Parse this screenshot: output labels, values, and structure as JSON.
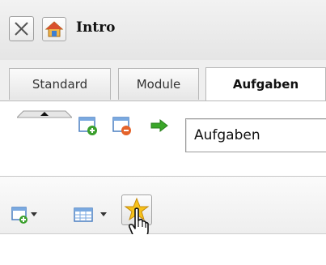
{
  "window": {
    "title": "Intro",
    "icons": {
      "close": "close-icon",
      "home": "home-icon"
    }
  },
  "tabs": [
    {
      "label": "Standard",
      "active": false
    },
    {
      "label": "Module",
      "active": false
    },
    {
      "label": "Aufgaben",
      "active": true
    }
  ],
  "toolbar": {
    "icons": [
      "collapse-handle-icon",
      "window-add-icon",
      "window-remove-icon",
      "arrow-right-icon"
    ],
    "select": {
      "value": "Aufgaben"
    }
  },
  "toolbar2": {
    "icons": [
      "new-window-dropdown-icon",
      "view-dropdown-icon",
      "favorite-star-icon",
      "hand-cursor-icon"
    ]
  },
  "colors": {
    "accent_green": "#3a9f2c",
    "accent_orange": "#e5632a",
    "star_yellow": "#f7c21a",
    "window_blue": "#4a7fc1"
  }
}
